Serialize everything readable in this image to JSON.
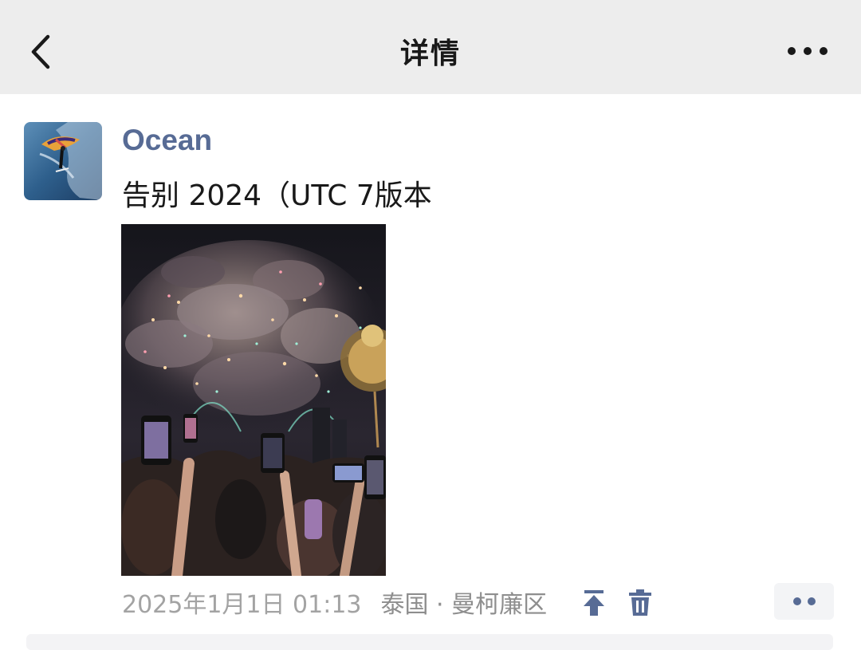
{
  "navbar": {
    "title": "详情",
    "back_icon": "chevron-left-icon",
    "more_icon": "more-horizontal-icon",
    "background": "#ededed"
  },
  "post": {
    "username": "Ocean",
    "username_color": "#576b95",
    "text": "告别 2024（UTC 7版本",
    "photo_description_icon": "fireworks-photo",
    "time": "2025年1月1日 01:13",
    "location": "泰国 · 曼柯廉区",
    "pin_icon": "pin-to-top-icon",
    "delete_icon": "trash-icon",
    "action_icon": "more-dots-icon"
  }
}
